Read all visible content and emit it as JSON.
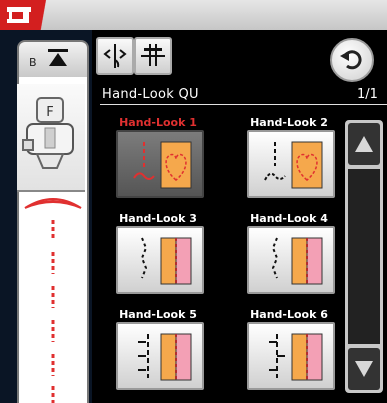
{
  "header": {
    "brand_icon": "sewing-machine-icon",
    "accent_color": "#d31f1f"
  },
  "left_panel": {
    "selector_label": "B",
    "foot_label": "F",
    "presser_foot_icon": "presser-foot-icon",
    "stitch_preview_icon": "stitch-preview-icon"
  },
  "toolbar": {
    "mirror_icon": "mirror-horizontal-icon",
    "needle_icon": "needle-position-icon",
    "back_icon": "back-arrow-icon"
  },
  "category": {
    "title": "Hand-Look QU",
    "page": "1/1"
  },
  "stitches": [
    {
      "label": "Hand-Look 1",
      "icon": "hand-look-heart-icon",
      "selected": true
    },
    {
      "label": "Hand-Look 2",
      "icon": "hand-look-heart-icon",
      "selected": false
    },
    {
      "label": "Hand-Look 3",
      "icon": "hand-look-edge-icon",
      "selected": false
    },
    {
      "label": "Hand-Look 4",
      "icon": "hand-look-edge-icon",
      "selected": false
    },
    {
      "label": "Hand-Look 5",
      "icon": "hand-look-straight-icon",
      "selected": false
    },
    {
      "label": "Hand-Look 6",
      "icon": "hand-look-straight-icon",
      "selected": false
    }
  ],
  "scrollbar": {
    "up_icon": "arrow-up-icon",
    "down_icon": "arrow-down-icon"
  },
  "colors": {
    "panel": "#0a1525",
    "stitch_red": "#e03030",
    "fabric_orange": "#f5a84c",
    "fabric_pink": "#f3a0b5"
  }
}
